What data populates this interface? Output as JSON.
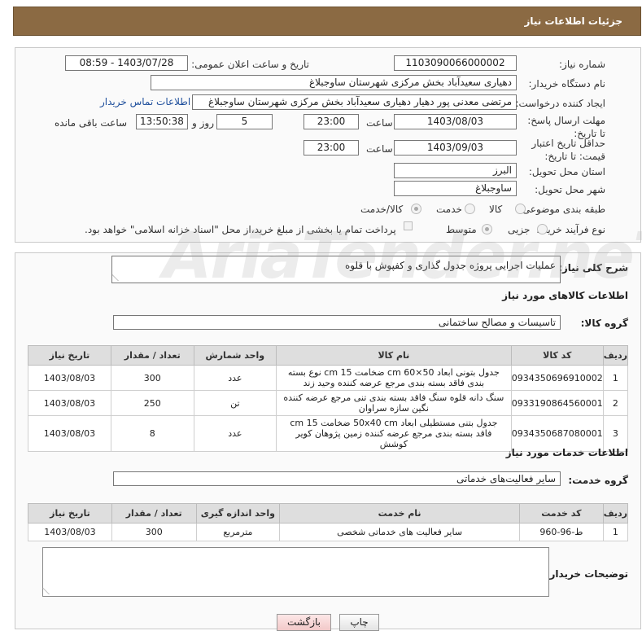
{
  "header": {
    "title": "جزئیات اطلاعات نیاز"
  },
  "fields": {
    "need_number": {
      "label": "شماره نیاز:",
      "value": "1103090066000002"
    },
    "announce_date": {
      "label": "تاریخ و ساعت اعلان عمومی:",
      "value": "1403/07/28 - 08:59"
    },
    "buyer_org": {
      "label": "نام دستگاه خریدار:",
      "value": "دهیاری سعیدآباد بخش مرکزی شهرستان ساوجبلاغ"
    },
    "requester": {
      "label": "ایجاد کننده درخواست:",
      "value": "مرتضی معدنی پور دهیار دهیاری سعیدآباد بخش مرکزی شهرستان ساوجبلاغ",
      "contact_link": "اطلاعات تماس خریدار"
    },
    "reply_deadline": {
      "label": "مهلت ارسال پاسخ: تا تاریخ:",
      "date": "1403/08/03",
      "time_label": "ساعت",
      "time": "23:00",
      "days": "5",
      "days_label": "روز و",
      "remaining": "13:50:38",
      "remaining_label": "ساعت باقی مانده"
    },
    "price_validity": {
      "label": "حداقل تاریخ اعتبار قیمت: تا تاریخ:",
      "date": "1403/09/03",
      "time_label": "ساعت",
      "time": "23:00"
    },
    "province": {
      "label": "استان محل تحویل:",
      "value": "البرز"
    },
    "city": {
      "label": "شهر محل تحویل:",
      "value": "ساوجبلاغ"
    },
    "category": {
      "label": "طبقه بندی موضوعی:",
      "options": [
        "کالا",
        "خدمت",
        "کالا/خدمت"
      ],
      "selected": "کالا/خدمت"
    },
    "process": {
      "label": "نوع فرآیند خرید :",
      "options": [
        "جزیی",
        "متوسط"
      ],
      "selected": "متوسط",
      "note": "پرداخت تمام یا بخشی از مبلغ خرید،از محل \"اسناد خزانه اسلامی\" خواهد بود."
    }
  },
  "description": {
    "label": "شرح کلی نیاز:",
    "value": "عملیات اجرایی پروژه جدول گذاری و کفپوش با قلوه"
  },
  "goods": {
    "title": "اطلاعات کالاهای مورد نیاز",
    "group_label": "گروه کالا:",
    "group_value": "تاسیسات و مصالح ساختمانی",
    "headers": [
      "ردیف",
      "کد کالا",
      "نام کالا",
      "واحد شمارش",
      "تعداد / مقدار",
      "تاریخ نیاز"
    ],
    "rows": [
      {
        "row": "1",
        "code": "0934350696910002",
        "name": "جدول بتونی ابعاد 50×60 cm ضخامت 15 cm نوع بسته بندی فاقد بسته بندی مرجع عرضه کننده وحید زند",
        "unit": "عدد",
        "qty": "300",
        "date": "1403/08/03"
      },
      {
        "row": "2",
        "code": "0933190864560001",
        "name": "سنگ دانه قلوه سنگ فاقد بسته بندی تنی مرجع عرضه کننده نگین سازه سراوان",
        "unit": "تن",
        "qty": "250",
        "date": "1403/08/03"
      },
      {
        "row": "3",
        "code": "0934350687080001",
        "name": "جدول بتنی مستطیلی ابعاد 50x40 cm ضخامت 15 cm فاقد بسته بندی مرجع عرضه کننده زمین پژوهان کویر کوشش",
        "unit": "عدد",
        "qty": "8",
        "date": "1403/08/03"
      }
    ]
  },
  "services": {
    "title": "اطلاعات خدمات مورد نیاز",
    "group_label": "گروه خدمت:",
    "group_value": "سایر فعالیت‌های خدماتی",
    "headers": [
      "ردیف",
      "کد خدمت",
      "نام خدمت",
      "واحد اندازه گیری",
      "تعداد / مقدار",
      "تاریخ نیاز"
    ],
    "rows": [
      {
        "row": "1",
        "code": "ط-96-960",
        "name": "سایر فعالیت های خدماتی شخصی",
        "unit": "مترمربع",
        "qty": "300",
        "date": "1403/08/03"
      }
    ]
  },
  "buyer_notes": {
    "label": "توضیحات خریدار:",
    "value": ""
  },
  "buttons": {
    "print": "چاپ",
    "back": "بازگشت"
  },
  "watermark": "AriaTender.neT"
}
